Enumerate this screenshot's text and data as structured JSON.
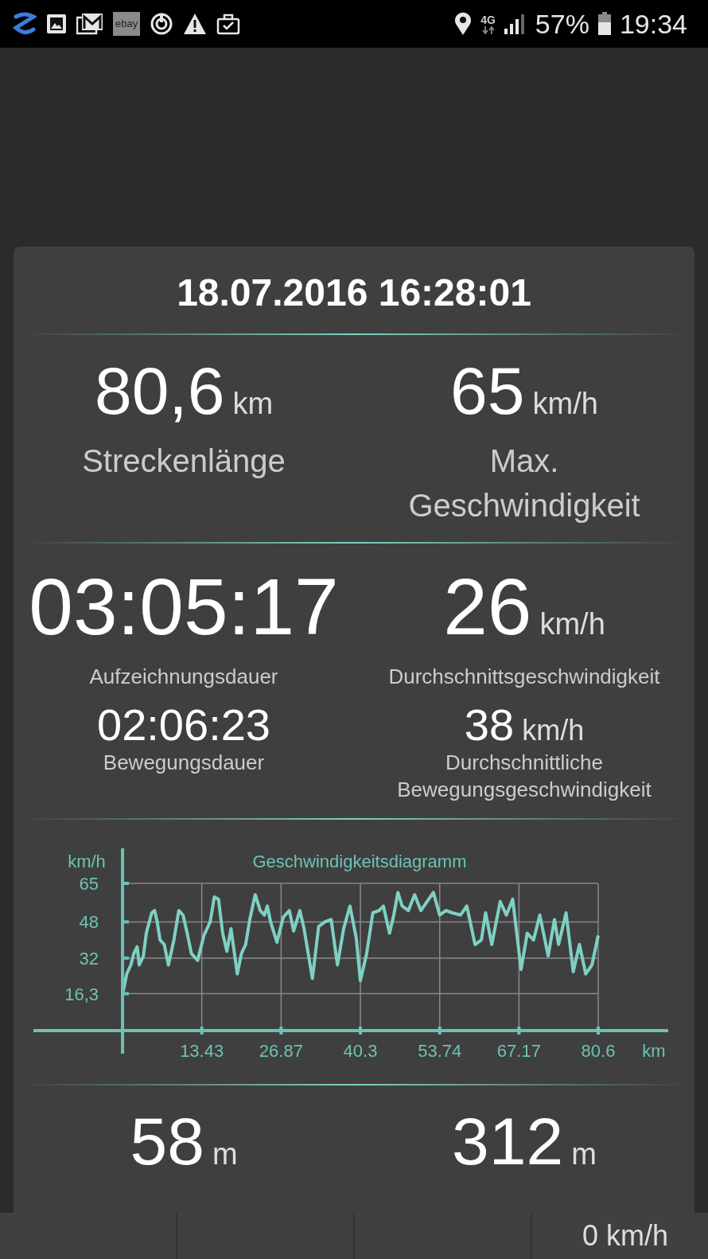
{
  "status_bar": {
    "badge": "ebay",
    "network": "4G",
    "battery": "57%",
    "time": "19:34"
  },
  "session": {
    "title": "18.07.2016 16:28:01"
  },
  "sections": [
    {
      "stats": [
        {
          "kind": "primary",
          "value": "80,6",
          "unit": "km",
          "label": "Streckenlänge"
        },
        {
          "kind": "primary",
          "value": "65",
          "unit": "km/h",
          "label": "Max. Geschwindigkeit"
        }
      ]
    },
    {
      "stats": [
        {
          "kind": "secondary",
          "value": "03:05:17",
          "label": "Aufzeichnungsdauer"
        },
        {
          "kind": "secondary",
          "value": "26",
          "unit": "km/h",
          "label": "Durchschnittsgeschwindigkeit"
        },
        {
          "kind": "tertiary",
          "value": "02:06:23",
          "label": "Bewegungsdauer"
        },
        {
          "kind": "tertiary",
          "value": "38",
          "unit": "km/h",
          "label": "Durchschnittliche Bewegungsgeschwindigkeit"
        }
      ]
    }
  ],
  "chart": {
    "chart_data": {
      "type": "line",
      "title": "Geschwindigkeitsdiagramm",
      "xlabel": "km",
      "ylabel": "km/h",
      "xlim": [
        -15.1,
        92.46
      ],
      "ylim": [
        0,
        65
      ],
      "grid": true,
      "xticks": [
        13.43,
        26.87,
        40.3,
        53.74,
        67.17,
        80.6
      ],
      "yticks": [
        {
          "value": 16.3,
          "label": "16,3"
        },
        32,
        48,
        65
      ],
      "x": [
        0,
        0.71,
        1.41,
        1.91,
        2.47,
        2.83,
        3.54,
        4.03,
        4.95,
        5.44,
        5.87,
        6.36,
        7.07,
        7.78,
        8.7,
        9.54,
        10.25,
        10.96,
        11.67,
        12.73,
        13.79,
        14.85,
        15.55,
        16.26,
        16.97,
        17.68,
        18.38,
        19.44,
        20.15,
        20.86,
        21.56,
        22.48,
        23.33,
        24.04,
        24.53,
        25.1,
        26.16,
        27.22,
        28.28,
        28.99,
        30.05,
        30.76,
        32.17,
        33.23,
        34.29,
        35.35,
        36.41,
        37.47,
        38.53,
        39.59,
        40.3,
        41.36,
        42.42,
        43.48,
        44.19,
        45.25,
        45.96,
        46.66,
        47.37,
        48.43,
        49.49,
        50.55,
        51.61,
        52.67,
        53.73,
        54.8,
        55.86,
        57.27,
        58.33,
        59.74,
        60.8,
        61.51,
        62.57,
        63.99,
        65.05,
        66.11,
        67.52,
        68.58,
        69.64,
        70.7,
        72.12,
        73.18,
        73.88,
        75.16,
        76.36,
        77.42,
        78.48,
        79.54,
        80.6
      ],
      "series": [
        {
          "color": "#7fd0c4",
          "values": [
            16,
            25,
            29,
            34,
            37,
            29,
            33,
            43,
            52,
            53,
            48,
            40,
            38,
            29,
            40,
            53,
            51,
            43,
            34,
            31,
            42,
            48,
            59,
            58,
            43,
            35,
            45,
            25,
            34,
            38,
            49,
            60,
            53,
            51,
            55,
            48,
            39,
            50,
            53,
            44,
            53,
            45,
            23,
            46,
            48,
            49,
            29,
            45,
            55,
            41,
            22,
            34,
            52,
            53,
            55,
            43,
            51,
            61,
            55,
            53,
            60,
            53,
            57,
            61,
            51,
            53,
            52,
            51,
            55,
            38,
            40,
            52,
            38,
            57,
            51,
            58,
            27,
            43,
            40,
            51,
            33,
            49,
            38,
            52,
            26,
            38,
            25,
            29,
            42
          ]
        }
      ]
    }
  },
  "elevation": {
    "stats": [
      {
        "kind": "primary",
        "value": "58",
        "unit": "m"
      },
      {
        "kind": "primary",
        "value": "312",
        "unit": "m"
      }
    ]
  },
  "bottom_bar": {
    "speed": "0 km/h"
  }
}
